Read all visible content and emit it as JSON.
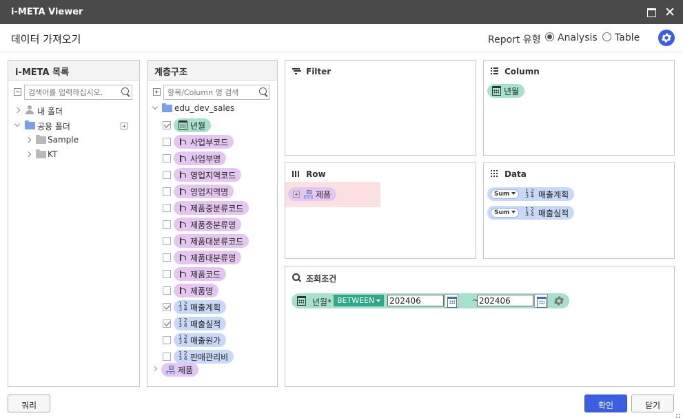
{
  "window": {
    "title": "i-META Viewer"
  },
  "header": {
    "title": "데이터 가져오기",
    "report_type_label": "Report 유형",
    "options": [
      {
        "label": "Analysis",
        "selected": true
      },
      {
        "label": "Table",
        "selected": false
      }
    ]
  },
  "meta_panel": {
    "title": "i-META 목록",
    "search_placeholder": "검색어를 입력하십시오.",
    "tree": [
      {
        "label": "내 폴더",
        "icon": "user-icon",
        "expanded": false
      },
      {
        "label": "공용 폴더",
        "icon": "folder-icon",
        "expanded": true
      },
      {
        "label": "Sample",
        "icon": "folder-icon",
        "expanded": false
      },
      {
        "label": "KT",
        "icon": "folder-icon",
        "expanded": false
      }
    ]
  },
  "hierarchy_panel": {
    "title": "계층구조",
    "search_placeholder": "항목/Column 명 검색",
    "root": "edu_dev_sales",
    "items": [
      {
        "label": "년월",
        "type": "date",
        "checked": true
      },
      {
        "label": "사업부코드",
        "type": "dimension",
        "checked": false
      },
      {
        "label": "사업부명",
        "type": "dimension",
        "checked": false
      },
      {
        "label": "영업지역코드",
        "type": "dimension",
        "checked": false
      },
      {
        "label": "영업지역명",
        "type": "dimension",
        "checked": false
      },
      {
        "label": "제품중분류코드",
        "type": "dimension",
        "checked": false
      },
      {
        "label": "제품중분류명",
        "type": "dimension",
        "checked": false
      },
      {
        "label": "제품대분류코드",
        "type": "dimension",
        "checked": false
      },
      {
        "label": "제품대분류명",
        "type": "dimension",
        "checked": false
      },
      {
        "label": "제품코드",
        "type": "dimension",
        "checked": false
      },
      {
        "label": "제품명",
        "type": "dimension",
        "checked": false
      },
      {
        "label": "매출계획",
        "type": "measure",
        "checked": true
      },
      {
        "label": "매출실적",
        "type": "measure",
        "checked": true
      },
      {
        "label": "매출원가",
        "type": "measure",
        "checked": false
      },
      {
        "label": "판매관리비",
        "type": "measure",
        "checked": false
      }
    ],
    "hierarchy_group": "제품"
  },
  "zones": {
    "filter": {
      "title": "Filter"
    },
    "column": {
      "title": "Column",
      "items": [
        "년월"
      ]
    },
    "row": {
      "title": "Row",
      "items": [
        "제품"
      ]
    },
    "data": {
      "title": "Data",
      "items": [
        {
          "agg": "Sum",
          "label": "매출계획"
        },
        {
          "agg": "Sum",
          "label": "매출실적"
        }
      ]
    },
    "condition": {
      "title": "조회조건",
      "field": "년월*",
      "operator": "BETWEEN",
      "from": "202406",
      "tilde": "~",
      "to": "202406"
    }
  },
  "footer": {
    "query_button": "쿼리",
    "ok_button": "확인",
    "close_button": "닫기"
  },
  "colors": {
    "accent": "#3b5fe0",
    "date_pill": "#a7e0cd",
    "dimension_pill": "#e4c6f0",
    "measure_pill": "#c8d8f8",
    "operator": "#2fa88a"
  }
}
